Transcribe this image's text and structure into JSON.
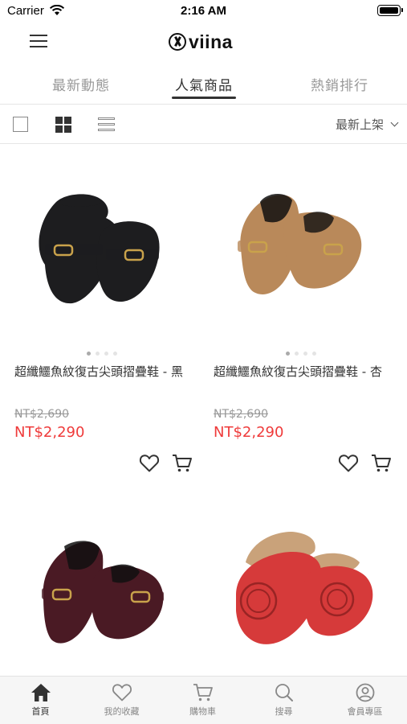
{
  "status_bar": {
    "carrier": "Carrier",
    "time": "2:16 AM"
  },
  "header": {
    "logo_text": "viina"
  },
  "tabs": [
    {
      "label": "最新動態",
      "active": false
    },
    {
      "label": "人氣商品",
      "active": true
    },
    {
      "label": "熱銷排行",
      "active": false
    }
  ],
  "toolbar": {
    "sort_label": "最新上架",
    "view_modes": [
      "single-icon",
      "grid-icon",
      "list-icon"
    ],
    "active_view": "grid-icon"
  },
  "products": [
    {
      "name": "超纖鱷魚紋復古尖頭摺疊鞋 - 黑",
      "original_price": "NT$2,690",
      "sale_price": "NT$2,290",
      "shoe_color": "#1d1d1f",
      "image_count": 4,
      "active_image": 1
    },
    {
      "name": "超纖鱷魚紋復古尖頭摺疊鞋 - 杏",
      "original_price": "NT$2,690",
      "sale_price": "NT$2,290",
      "shoe_color": "#b9895a",
      "image_count": 4,
      "active_image": 1
    },
    {
      "name": "",
      "original_price": "",
      "sale_price": "",
      "shoe_color": "#4a1a24"
    },
    {
      "name": "",
      "original_price": "",
      "sale_price": "",
      "shoe_color": "#d63a3a"
    }
  ],
  "bottom_nav": [
    {
      "label": "首頁",
      "icon": "home-icon",
      "active": true
    },
    {
      "label": "我的收藏",
      "icon": "heart-icon",
      "active": false
    },
    {
      "label": "購物車",
      "icon": "cart-icon",
      "active": false
    },
    {
      "label": "搜尋",
      "icon": "search-icon",
      "active": false
    },
    {
      "label": "會員專區",
      "icon": "user-icon",
      "active": false
    }
  ],
  "colors": {
    "sale_price": "#ef3b3b",
    "text_primary": "#333333",
    "text_muted": "#999999",
    "tab_bar_bg": "#f6f6f6"
  }
}
